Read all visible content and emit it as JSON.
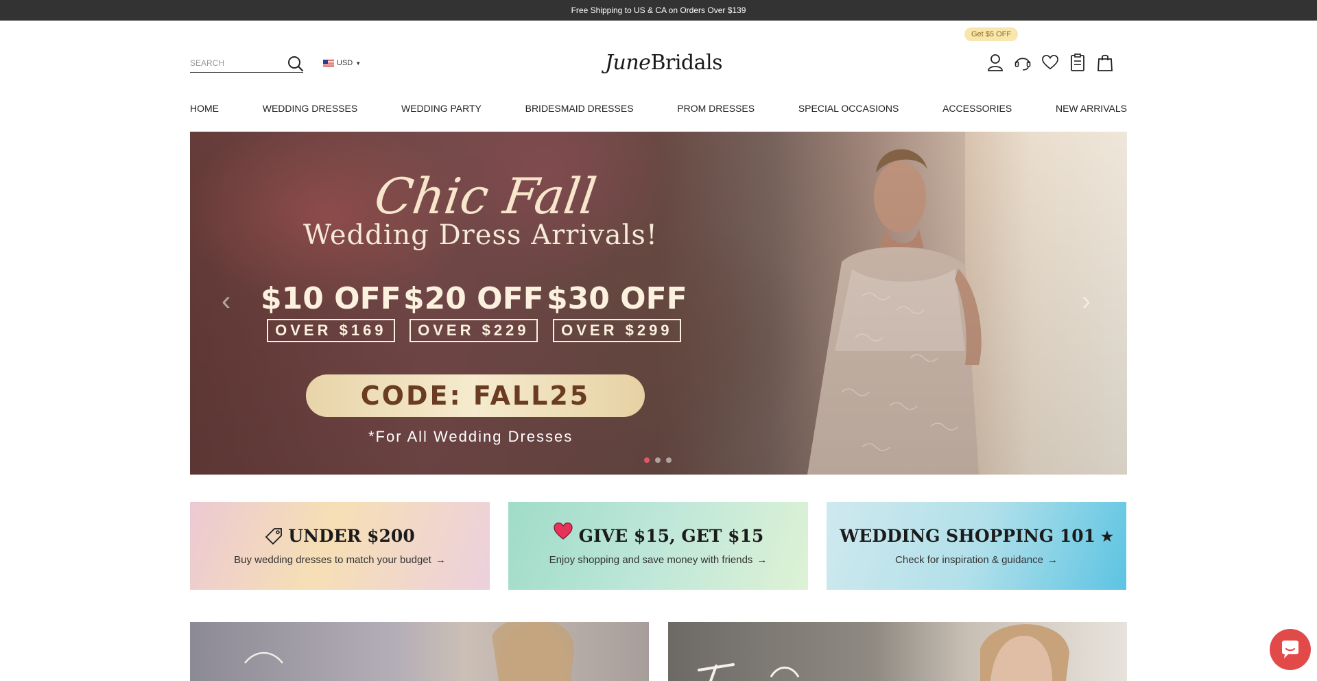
{
  "announcement": "Free Shipping to US & CA on Orders Over $139",
  "search": {
    "placeholder": "SEARCH"
  },
  "currency": "USD",
  "logo": {
    "part1": "June",
    "part2": "Bridals"
  },
  "promo_pill": "Get $5 OFF",
  "header_icons": [
    "account-icon",
    "support-icon",
    "wishlist-icon",
    "orders-icon",
    "cart-icon"
  ],
  "nav": [
    "HOME",
    "WEDDING DRESSES",
    "WEDDING PARTY",
    "BRIDESMAID DRESSES",
    "PROM DRESSES",
    "SPECIAL OCCASIONS",
    "ACCESSORIES",
    "NEW ARRIVALS"
  ],
  "hero": {
    "title": "Chic Fall",
    "subtitle": "Wedding Dress Arrivals!",
    "offers": [
      {
        "amount": "$10 OFF",
        "min": "OVER $169"
      },
      {
        "amount": "$20 OFF",
        "min": "OVER $229"
      },
      {
        "amount": "$30 OFF",
        "min": "OVER $299"
      }
    ],
    "code": "CODE: FALL25",
    "note": "*For All Wedding Dresses",
    "prev": "‹",
    "next": "›",
    "slide_count": 3,
    "active_slide": 1
  },
  "cards": [
    {
      "title": "UNDER $200",
      "text": "Buy wedding dresses to match your budget",
      "icon": "tag-icon"
    },
    {
      "title": "GIVE $15, GET $15",
      "text": "Enjoy shopping and save money with friends",
      "icon": "heart-icon"
    },
    {
      "title": "WEDDING SHOPPING 101",
      "title_suffix": "★",
      "text": "Check for inspiration & guidance"
    }
  ],
  "colors": {
    "topbar": "#333333",
    "pill_bg": "#f8e6ad",
    "code_text": "#6a3d22",
    "dot_active": "#e0576b",
    "chat": "#e24a4a"
  }
}
